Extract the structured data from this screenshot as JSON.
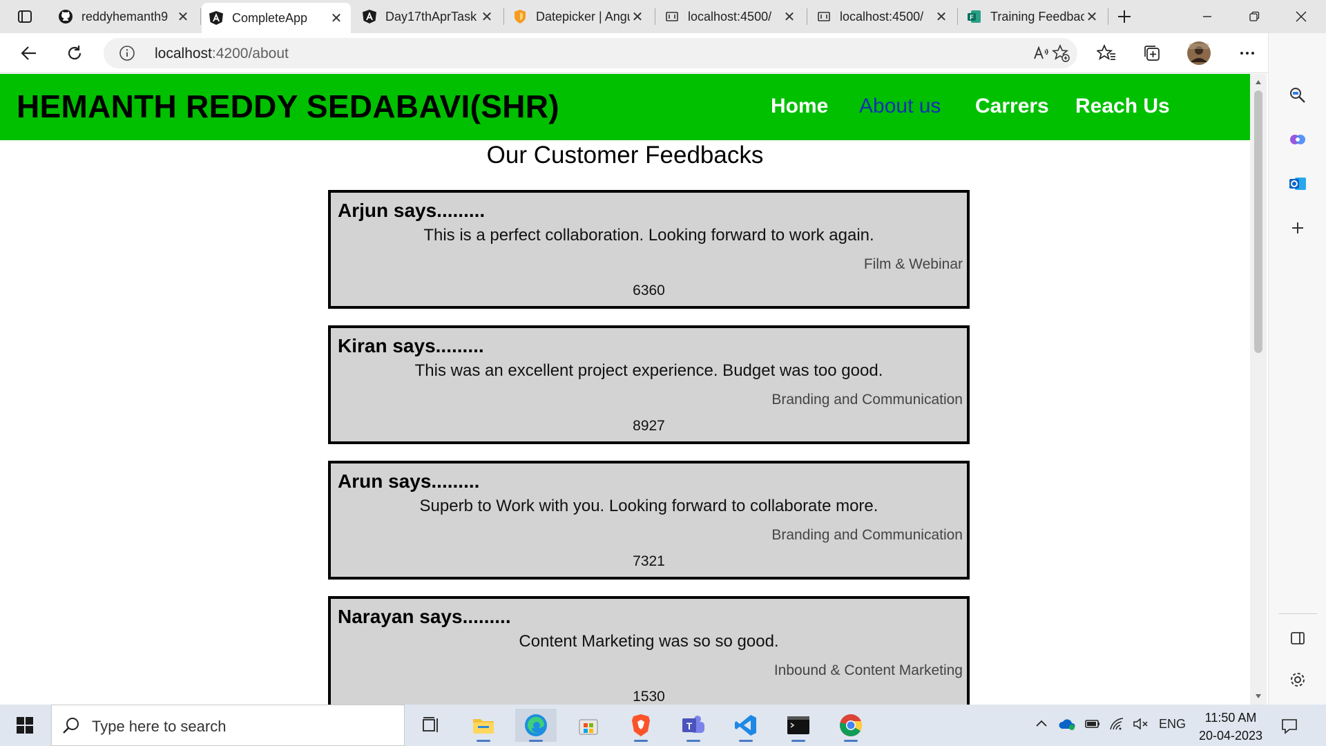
{
  "tabs": [
    {
      "title": "reddyhemanth9",
      "icon": "github-icon"
    },
    {
      "title": "CompleteApp",
      "icon": "angular-icon"
    },
    {
      "title": "Day17thAprTask",
      "icon": "angular-icon"
    },
    {
      "title": "Datepicker | Angular",
      "icon": "brave-shield-icon"
    },
    {
      "title": "localhost:4500/",
      "icon": "localhost-icon"
    },
    {
      "title": "localhost:4500/",
      "icon": "localhost-icon"
    },
    {
      "title": "Training Feedback",
      "icon": "forms-icon"
    }
  ],
  "address": {
    "host": "localhost",
    "rest": ":4200/about"
  },
  "site": {
    "brand": "HEMANTH REDDY SEDABAVI(SHR)",
    "nav": {
      "home": "Home",
      "about": "About us",
      "careers": "Carrers",
      "reach": "Reach Us"
    },
    "active_nav": "About us",
    "header_color": "#00c000",
    "active_nav_color": "#1430b4"
  },
  "page_title": "Our Customer Feedbacks",
  "feedbacks": [
    {
      "name": "Arjun says.........",
      "message": "This is a perfect collaboration. Looking forward to work again.",
      "category": "Film & Webinar",
      "number": "6360"
    },
    {
      "name": "Kiran says.........",
      "message": "This was an excellent project experience. Budget was too good.",
      "category": "Branding and Communication",
      "number": "8927"
    },
    {
      "name": "Arun says.........",
      "message": "Superb to Work with you. Looking forward to collaborate more.",
      "category": "Branding and Communication",
      "number": "7321"
    },
    {
      "name": "Narayan says.........",
      "message": "Content Marketing was so so good.",
      "category": "Inbound & Content Marketing",
      "number": "1530"
    }
  ],
  "taskbar": {
    "search_placeholder": "Type here to search",
    "language": "ENG",
    "time": "11:50 AM",
    "date": "20-04-2023"
  }
}
